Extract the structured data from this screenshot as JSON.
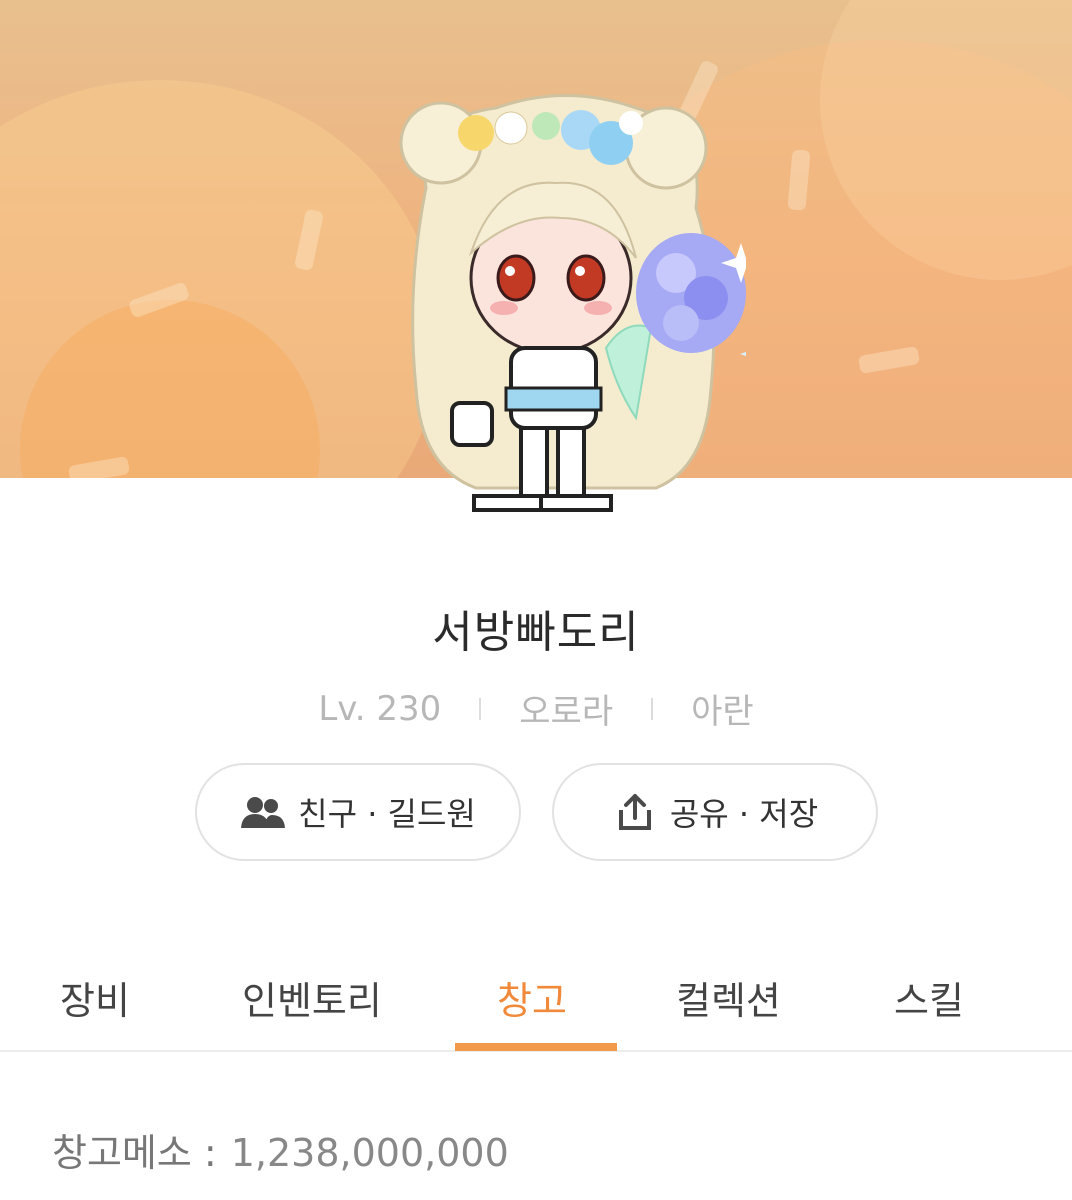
{
  "character": {
    "name": "서방빠도리",
    "level": "Lv. 230",
    "world": "오로라",
    "job": "아란"
  },
  "actions": {
    "friends_guild": "친구 · 길드원",
    "share_save": "공유 · 저장"
  },
  "tabs": [
    {
      "label": "장비"
    },
    {
      "label": "인벤토리"
    },
    {
      "label": "창고",
      "active": true
    },
    {
      "label": "컬렉션"
    },
    {
      "label": "스킬"
    }
  ],
  "storage": {
    "meso_label": "창고메소 :",
    "meso_value": "1,238,000,000"
  },
  "colors": {
    "accent": "#f08a3a",
    "banner": "#efb27e"
  },
  "icons": {
    "friends": "people-icon",
    "share": "share-upload-icon"
  }
}
